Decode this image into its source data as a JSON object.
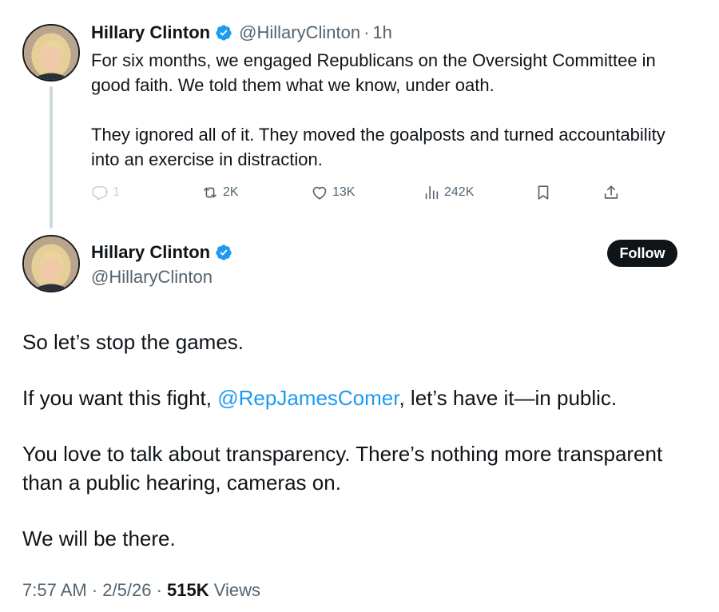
{
  "reply_tweet": {
    "author_name": "Hillary Clinton",
    "handle": "@HillaryClinton",
    "separator": "·",
    "time_ago": "1h",
    "paragraphs": [
      "For six months, we engaged Republicans on the Oversight Committee in good faith. We told them what we know, under oath.",
      "They ignored all of it. They moved the goalposts and turned accountability into an exercise in distraction."
    ],
    "actions": {
      "reply_count": "1",
      "retweet_count": "2K",
      "like_count": "13K",
      "view_count": "242K"
    }
  },
  "main_tweet": {
    "author_name": "Hillary Clinton",
    "handle": "@HillaryClinton",
    "follow_label": "Follow",
    "p1": "So let’s stop the games.",
    "p2_before": "If you want this fight, ",
    "p2_mention": "@RepJamesComer",
    "p2_after": ", let’s have it—in public.",
    "p3": "You love to talk about transparency. There’s nothing more transparent than a public hearing, cameras on.",
    "p4": "We will be there.",
    "time": "7:57 AM",
    "date": "2/5/26",
    "views_count": "515K",
    "views_label": "Views",
    "separator": "·"
  },
  "colors": {
    "text": "#0f1419",
    "muted": "#536471",
    "verified": "#1d9bf0",
    "mention": "#1d9bf0",
    "button_bg": "#0f1419"
  },
  "icons": [
    "verified-badge-icon",
    "reply-icon",
    "retweet-icon",
    "like-icon",
    "views-icon",
    "bookmark-icon",
    "share-icon"
  ]
}
